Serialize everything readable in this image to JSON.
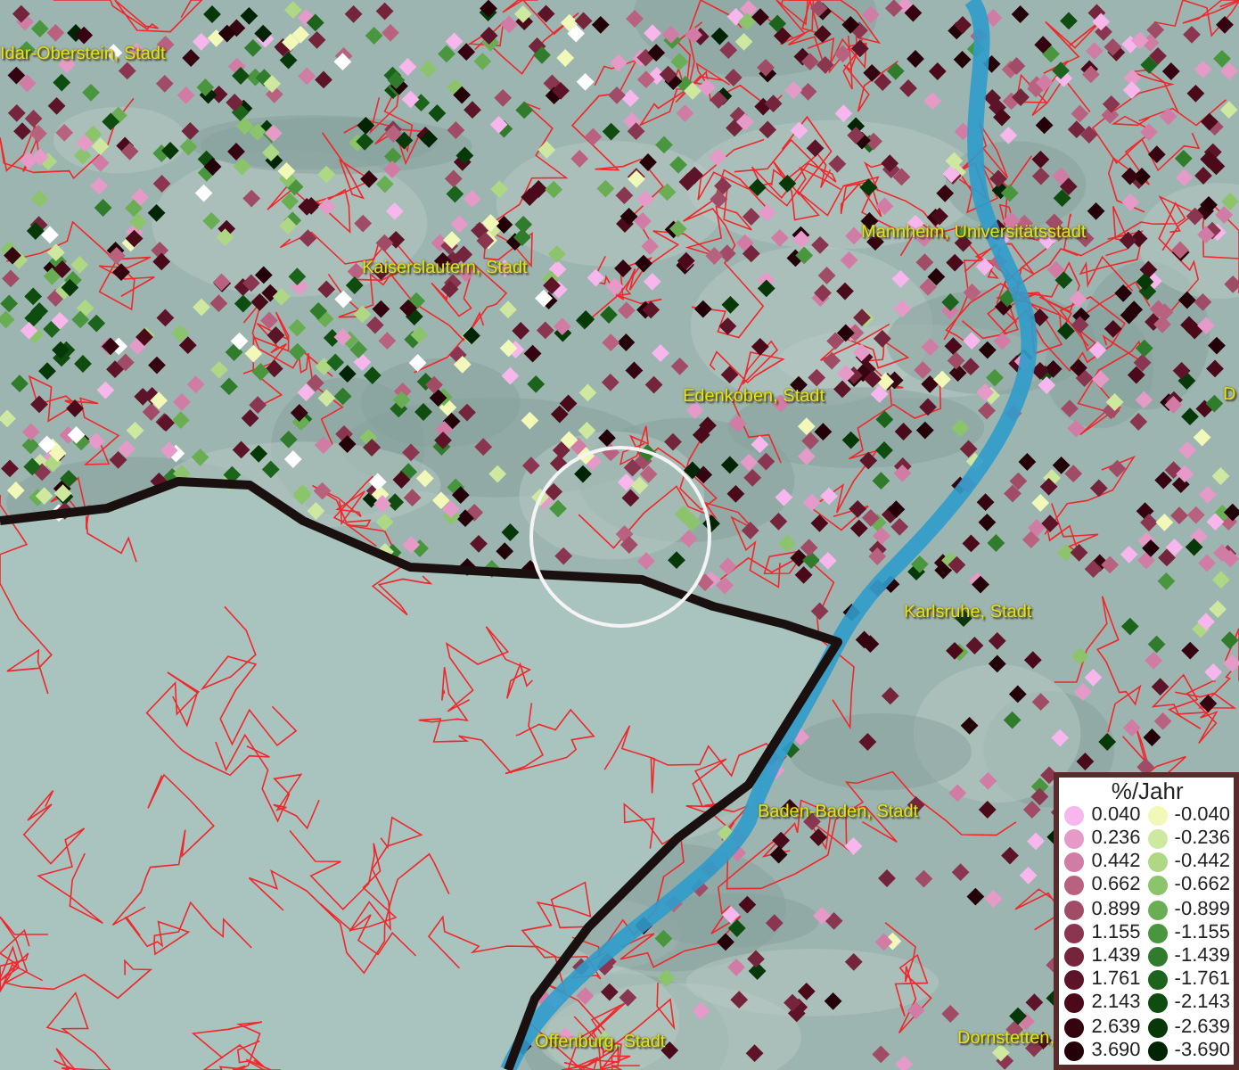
{
  "map": {
    "place_labels": [
      {
        "text": "Idar-Oberstein, Stadt"
      },
      {
        "text": "Kaiserslautern, Stadt"
      },
      {
        "text": "Mannheim, Universitätsstadt"
      },
      {
        "text": "Edenkoben, Stadt"
      },
      {
        "text": "D"
      },
      {
        "text": "Karlsruhe, Stadt"
      },
      {
        "text": "Baden-Baden, Stadt"
      },
      {
        "text": "Offenburg, Stadt"
      },
      {
        "text": "Dornstetten,"
      }
    ]
  },
  "legend": {
    "title": "%/Jahr",
    "increase": [
      {
        "value": "0.040",
        "color": "#f7b6ec"
      },
      {
        "value": "0.236",
        "color": "#e59ac8"
      },
      {
        "value": "0.442",
        "color": "#d07ca4"
      },
      {
        "value": "0.662",
        "color": "#b9627f"
      },
      {
        "value": "0.899",
        "color": "#a14c67"
      },
      {
        "value": "1.155",
        "color": "#8a3650"
      },
      {
        "value": "1.439",
        "color": "#74243b"
      },
      {
        "value": "1.761",
        "color": "#5e1428"
      },
      {
        "value": "2.143",
        "color": "#4a0a1a"
      },
      {
        "value": "2.639",
        "color": "#360410"
      },
      {
        "value": "3.690",
        "color": "#240008"
      }
    ],
    "decrease": [
      {
        "value": "-0.040",
        "color": "#f2f8b8"
      },
      {
        "value": "-0.236",
        "color": "#cfe8a0"
      },
      {
        "value": "-0.442",
        "color": "#aed884"
      },
      {
        "value": "-0.662",
        "color": "#8cc46c"
      },
      {
        "value": "-0.899",
        "color": "#6aae54"
      },
      {
        "value": "-1.155",
        "color": "#4a963e"
      },
      {
        "value": "-1.439",
        "color": "#317c2c"
      },
      {
        "value": "-1.761",
        "color": "#1c641c"
      },
      {
        "value": "-2.143",
        "color": "#0e4c10"
      },
      {
        "value": "-2.639",
        "color": "#063808"
      },
      {
        "value": "-3.690",
        "color": "#012404"
      }
    ]
  }
}
